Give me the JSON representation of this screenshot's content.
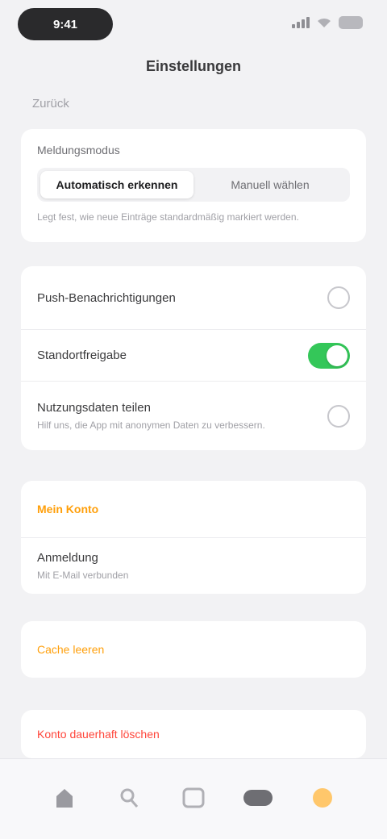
{
  "status": {
    "time": "9:41"
  },
  "nav": {
    "title": "Einstellungen",
    "back": "Zurück"
  },
  "flag_card": {
    "label": "Meldungsmodus",
    "options": [
      "Automatisch erkennen",
      "Manuell wählen"
    ],
    "help": "Legt fest, wie neue Einträge standardmäßig markiert werden."
  },
  "toggles": [
    {
      "title": "Push-Benachrichtigungen",
      "state": "off"
    },
    {
      "title": "Standortfreigabe",
      "state": "on"
    },
    {
      "title": "Nutzungsdaten teilen",
      "sub": "Hilf uns, die App mit anonymen Daten zu verbessern.",
      "state": "off"
    }
  ],
  "account": {
    "heading": "Mein Konto",
    "title": "Anmeldung",
    "sub": "Mit E-Mail verbunden"
  },
  "warn": {
    "label": "Cache leeren"
  },
  "danger": {
    "label": "Konto dauerhaft löschen"
  },
  "colors": {
    "accent": "#ff9f0a",
    "toggle_on": "#34c759",
    "danger": "#ff453a"
  },
  "tabs": [
    "home-icon",
    "search-icon",
    "grid-icon",
    "chat-icon",
    "settings-icon"
  ]
}
